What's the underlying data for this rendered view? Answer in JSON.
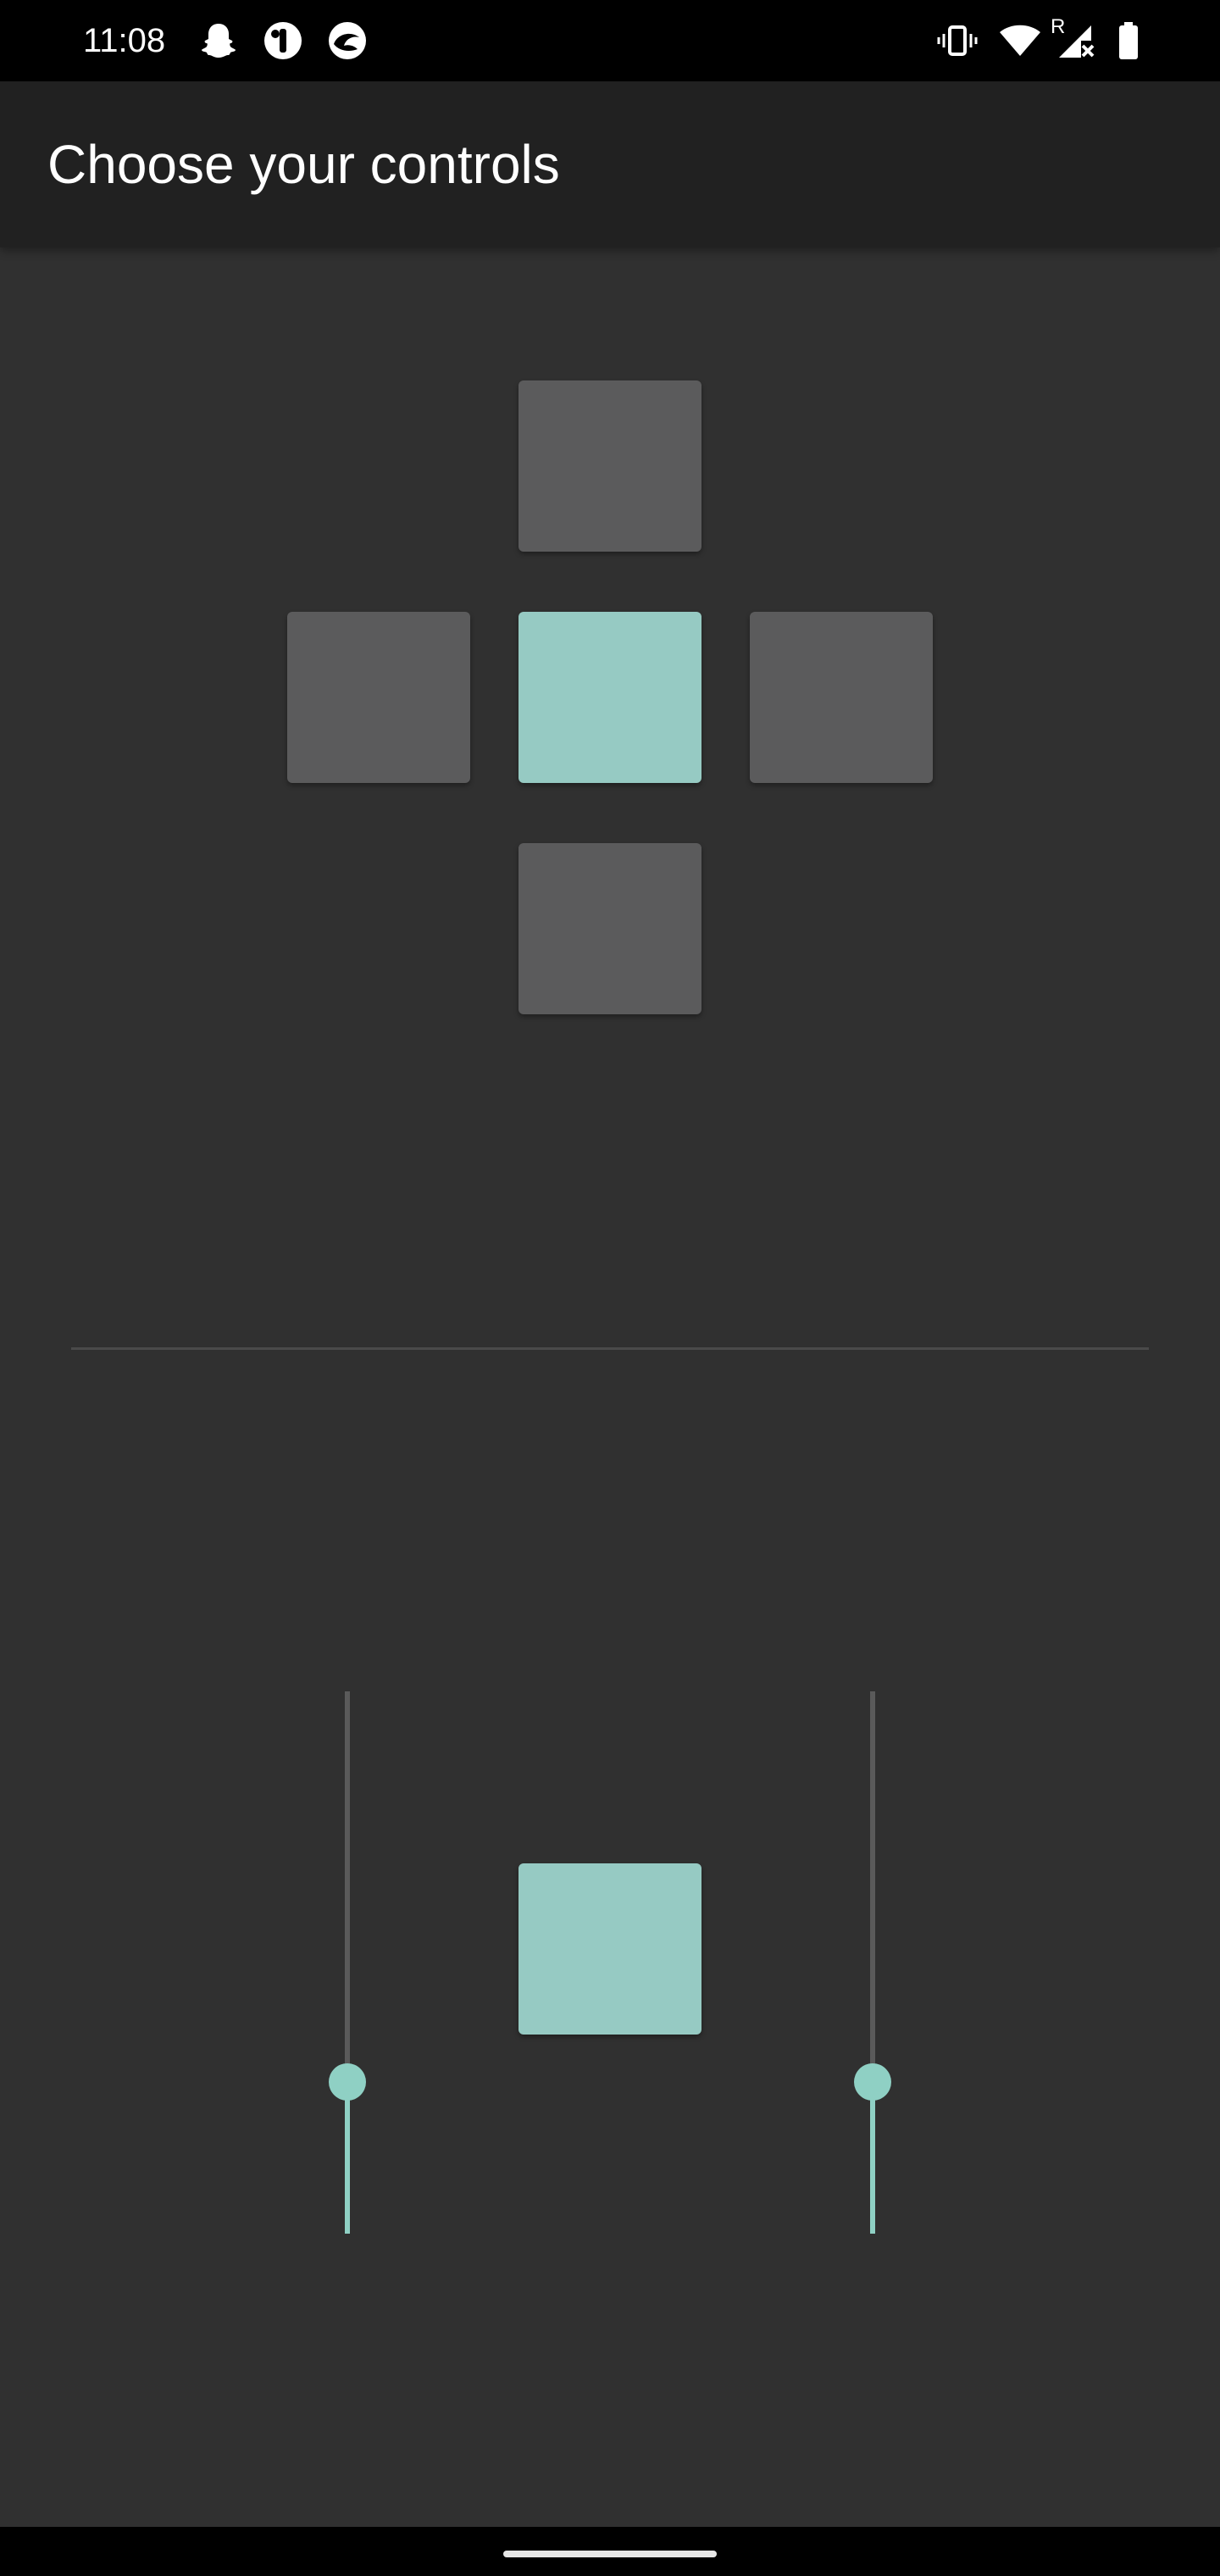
{
  "status_bar": {
    "time": "11:08",
    "network_letter": "R",
    "left_icons": [
      "snapchat-icon",
      "app-icon-half-circle",
      "app-icon-swirl"
    ],
    "right_icons": [
      "vibrate-icon",
      "wifi-icon",
      "cell-signal-no-data-icon",
      "battery-icon"
    ]
  },
  "app_bar": {
    "title": "Choose your controls"
  },
  "dpad": {
    "buttons": [
      "up",
      "left",
      "center",
      "right",
      "down"
    ],
    "selected": "center",
    "inactive_color": "#5b5b5c",
    "active_color": "#96cac3"
  },
  "sliders": [
    {
      "name": "left-slider",
      "value_fraction": 0.28
    },
    {
      "name": "right-slider",
      "value_fraction": 0.28
    }
  ],
  "action_button": {
    "color": "#96cac3"
  },
  "accent_color": "#8fd0c4",
  "background_color": "#303030"
}
